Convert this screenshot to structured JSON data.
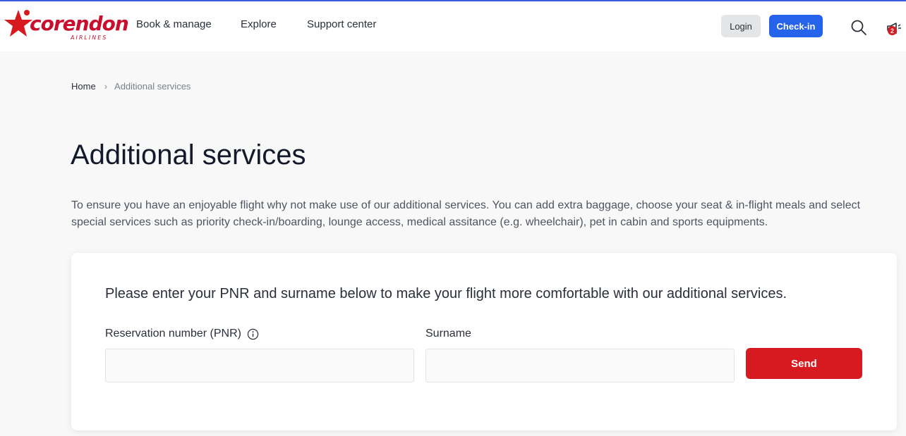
{
  "brand": {
    "name": "corendon",
    "sub": "AIRLINES",
    "color": "#c8102e"
  },
  "nav": {
    "items": [
      "Book & manage",
      "Explore",
      "Support center"
    ],
    "login_label": "Login",
    "checkin_label": "Check-in",
    "notification_count": "2",
    "icons": [
      "search-icon",
      "megaphone-icon"
    ]
  },
  "breadcrumb": {
    "home": "Home",
    "current": "Additional services"
  },
  "page": {
    "title": "Additional services",
    "intro": "To ensure you have an enjoyable flight why not make use of our additional services. You can add extra baggage, choose your seat & in-flight meals and select special services such as priority check-in/boarding, lounge access, medical assitance (e.g. wheelchair), pet in cabin and sports equipments."
  },
  "form": {
    "prompt": "Please enter your PNR and surname below to make your flight more comfortable with our additional services.",
    "pnr_label": "Reservation number (PNR)",
    "pnr_value": "",
    "surname_label": "Surname",
    "surname_value": "",
    "send_label": "Send"
  },
  "colors": {
    "accent_blue": "#2563eb",
    "accent_red": "#d71920",
    "top_line": "#3b5bdb"
  }
}
